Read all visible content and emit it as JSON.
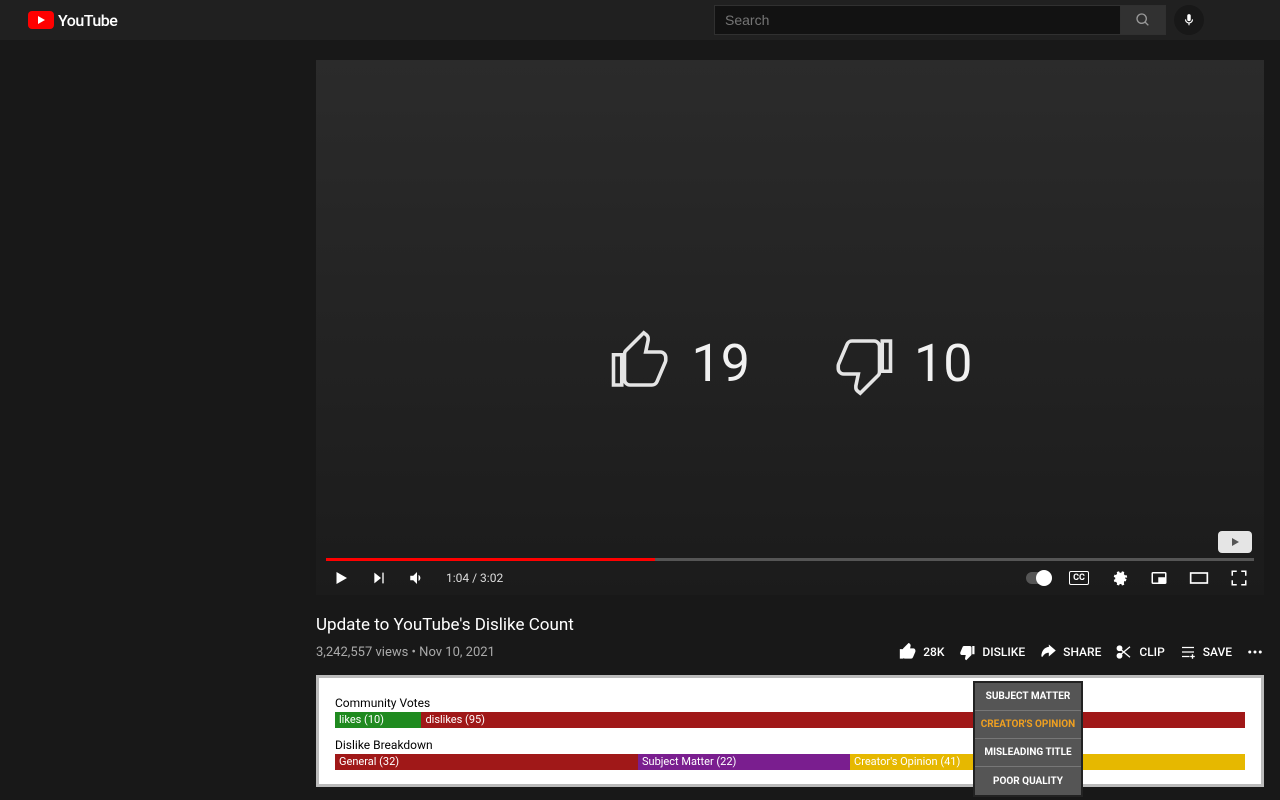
{
  "header": {
    "logo_text": "YouTube",
    "search_placeholder": "Search"
  },
  "player": {
    "like_count": "19",
    "dislike_count": "10",
    "current_time": "1:04",
    "duration": "3:02"
  },
  "video": {
    "title": "Update to YouTube's Dislike Count",
    "views": "3,242,557 views",
    "date": "Nov 10, 2021"
  },
  "actions": {
    "like_count": "28K",
    "dislike_label": "DISLIKE",
    "share_label": "SHARE",
    "clip_label": "CLIP",
    "save_label": "SAVE"
  },
  "vote_panel": {
    "community_label": "Community Votes",
    "community_segments": [
      {
        "label": "likes (10)",
        "color": "#1f8a1f",
        "width": "9.5"
      },
      {
        "label": "dislikes (95)",
        "color": "#a01818",
        "width": "90.5"
      }
    ],
    "breakdown_label": "Dislike Breakdown",
    "breakdown_segments": [
      {
        "label": "General (32)",
        "color": "#a01818",
        "width": "33.3"
      },
      {
        "label": "Subject Matter (22)",
        "color": "#7a1e8f",
        "width": "23.3"
      },
      {
        "label": "Creator's Opinion (41)",
        "color": "#e6b800",
        "width": "43.4"
      }
    ]
  },
  "dropdown": {
    "items": [
      {
        "label": "SUBJECT MATTER",
        "highlight": false
      },
      {
        "label": "CREATOR'S OPINION",
        "highlight": true
      },
      {
        "label": "MISLEADING TITLE",
        "highlight": false
      },
      {
        "label": "POOR QUALITY",
        "highlight": false
      }
    ]
  }
}
